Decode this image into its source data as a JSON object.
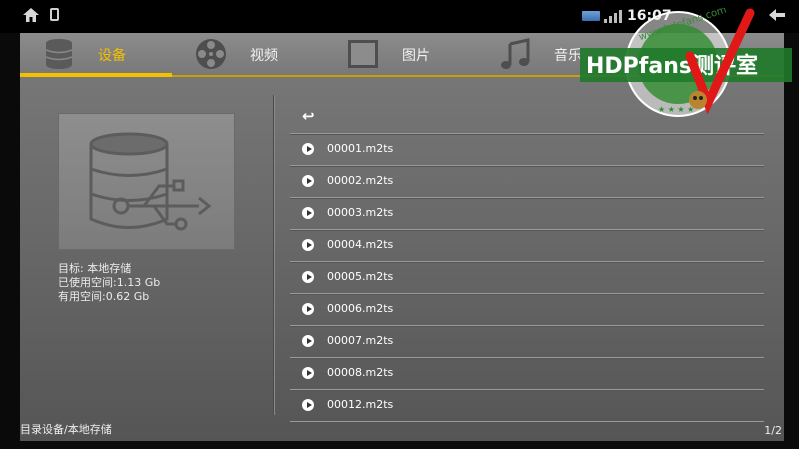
{
  "statusbar": {
    "time": "16:07"
  },
  "tabs": [
    {
      "label": "设备",
      "icon": "database-icon",
      "active": true
    },
    {
      "label": "视频",
      "icon": "film-reel-icon",
      "active": false
    },
    {
      "label": "图片",
      "icon": "picture-icon",
      "active": false
    },
    {
      "label": "音乐",
      "icon": "music-note-icon",
      "active": false
    }
  ],
  "device_info": {
    "target": "目标: 本地存储",
    "used": "已使用空间:1.13 Gb",
    "free": "有用空间:0.62 Gb"
  },
  "files": [
    "00001.m2ts",
    "00002.m2ts",
    "00003.m2ts",
    "00004.m2ts",
    "00005.m2ts",
    "00006.m2ts",
    "00007.m2ts",
    "00008.m2ts",
    "00012.m2ts"
  ],
  "footer": {
    "path": "目录设备/本地存储",
    "page": "1/2"
  },
  "watermark": {
    "text": "HDPfans测评室",
    "url_text": "www.hdpfans.com"
  },
  "colors": {
    "accent": "#f5c000",
    "panel": "#6e6e6e"
  }
}
